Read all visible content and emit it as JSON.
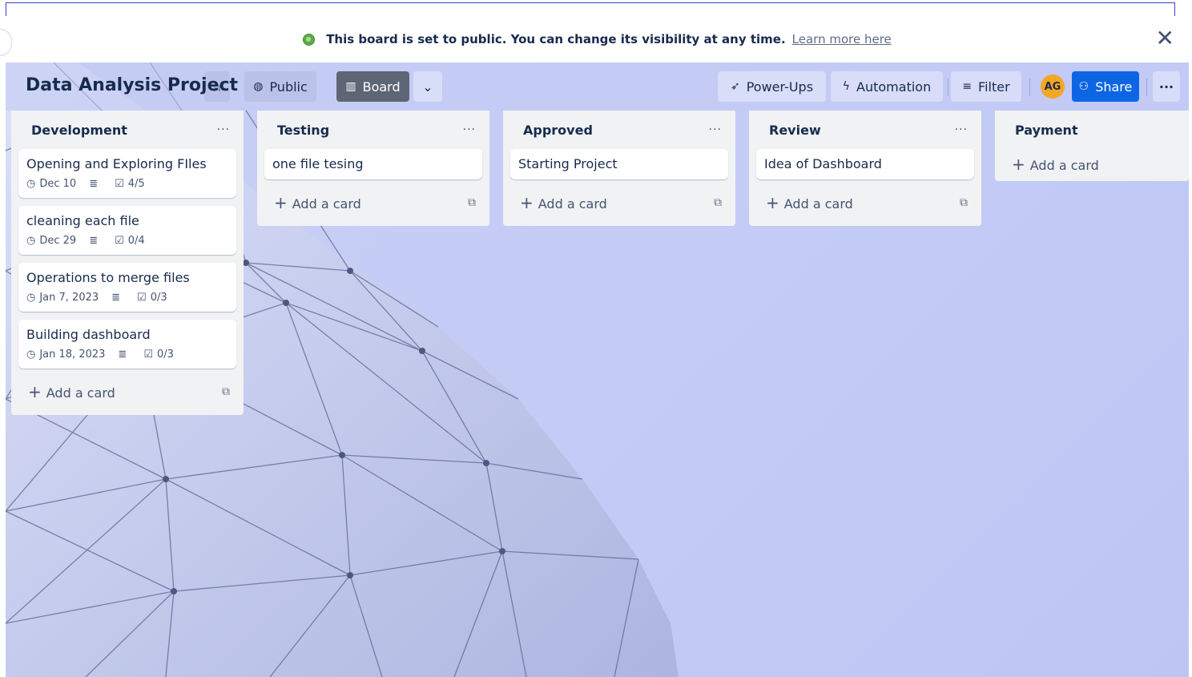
{
  "banner": {
    "message": "This board is set to public. You can change its visibility at any time.",
    "link": "Learn more here",
    "close": "✕"
  },
  "header": {
    "title": "Data Analysis Project",
    "star": "☆",
    "visibility": "Public",
    "view": "Board",
    "view_chevron": "⌄",
    "powerups": "Power-Ups",
    "automation": "Automation",
    "filter": "Filter",
    "avatar_initials": "AG",
    "share": "Share",
    "more": "···"
  },
  "add_card_label": "Add a card",
  "lists": [
    {
      "title": "Development",
      "cards": [
        {
          "title": "Opening and Exploring FIles",
          "date": "Dec 10",
          "checklist": "4/5"
        },
        {
          "title": "cleaning each file",
          "date": "Dec 29",
          "checklist": "0/4"
        },
        {
          "title": "Operations to merge files",
          "date": "Jan 7, 2023",
          "checklist": "0/3"
        },
        {
          "title": "Building dashboard",
          "date": "Jan 18, 2023",
          "checklist": "0/3"
        }
      ]
    },
    {
      "title": "Testing",
      "cards": [
        {
          "title": "one file tesing"
        }
      ]
    },
    {
      "title": "Approved",
      "cards": [
        {
          "title": "Starting Project"
        }
      ]
    },
    {
      "title": "Review",
      "cards": [
        {
          "title": "Idea of Dashboard"
        }
      ]
    },
    {
      "title": "Payment",
      "cards": []
    }
  ],
  "colors": {
    "board_bg": "#c4ccf6",
    "share": "#0c66e4",
    "avatar": "#f5a623",
    "list_bg": "#f1f2f4"
  }
}
